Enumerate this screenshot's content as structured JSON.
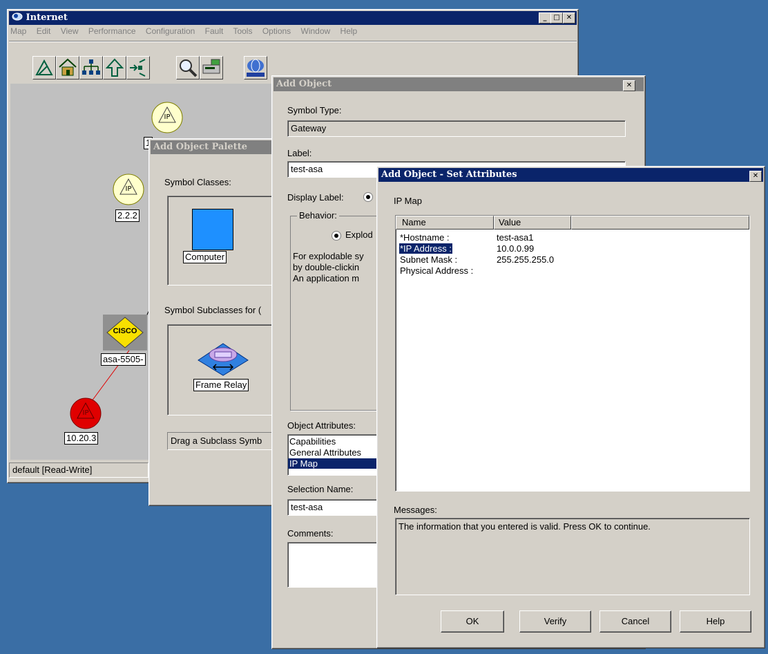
{
  "main": {
    "title": "Internet",
    "menu": [
      "Map",
      "Edit",
      "View",
      "Performance",
      "Configuration",
      "Fault",
      "Tools",
      "Options",
      "Window",
      "Help"
    ],
    "nodes": [
      "1",
      "2.2.2",
      "asa-5505-",
      "10.20.3"
    ],
    "status": "default [Read-Write]",
    "cisco_text": "CISCO"
  },
  "palette": {
    "title": "Add Object Palette",
    "symbol_classes_label": "Symbol Classes:",
    "class_item": "Computer",
    "subclasses_label": "Symbol Subclasses for (",
    "subclass_item": "Frame Relay",
    "hint": "Drag a Subclass Symb"
  },
  "addobj": {
    "title": "Add Object",
    "symbol_type_label": "Symbol Type:",
    "symbol_type_value": "Gateway",
    "label_label": "Label:",
    "label_value": "test-asa",
    "display_label": "Display Label:",
    "behavior_label": "Behavior:",
    "explod": "Explod",
    "desc": [
      "For explodable sy",
      "by double-clickin",
      "An application m"
    ],
    "attrs_label": "Object Attributes:",
    "attrs": [
      "Capabilities",
      "General Attributes",
      "IP Map"
    ],
    "selection_name_label": "Selection Name:",
    "selection_name_value": "test-asa",
    "comments_label": "Comments:"
  },
  "setattr": {
    "title": "Add Object - Set Attributes",
    "section": "IP Map",
    "col_name": "Name",
    "col_value": "Value",
    "rows": [
      {
        "name": "*Hostname :",
        "value": "test-asa1"
      },
      {
        "name": "*IP Address :",
        "value": "10.0.0.99"
      },
      {
        "name": "Subnet Mask :",
        "value": "255.255.255.0"
      },
      {
        "name": "Physical Address :",
        "value": ""
      }
    ],
    "messages_label": "Messages:",
    "message": "The information that you entered is valid.  Press OK to continue.",
    "buttons": {
      "ok": "OK",
      "verify": "Verify",
      "cancel": "Cancel",
      "help": "Help"
    }
  },
  "colors": {
    "desktop": "#3a6ea5",
    "active_title": "#0a246a",
    "inactive_title": "#808080",
    "node_yellow": "#ffffcc",
    "node_red": "#e00000"
  }
}
